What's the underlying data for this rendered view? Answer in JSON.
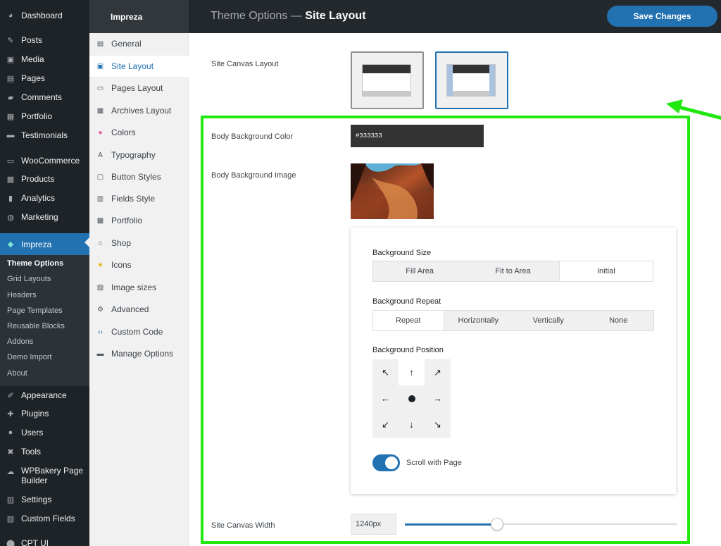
{
  "nav": {
    "items": [
      {
        "label": "Dashboard",
        "icon": "dashboard-icon",
        "glyph": "◕"
      },
      {
        "label": "Posts",
        "icon": "pin-icon",
        "glyph": "✎"
      },
      {
        "label": "Media",
        "icon": "media-icon",
        "glyph": "▣"
      },
      {
        "label": "Pages",
        "icon": "pages-icon",
        "glyph": "▤"
      },
      {
        "label": "Comments",
        "icon": "comments-icon",
        "glyph": "▰"
      },
      {
        "label": "Portfolio",
        "icon": "portfolio-icon",
        "glyph": "▦"
      },
      {
        "label": "Testimonials",
        "icon": "testimonials-icon",
        "glyph": "▬"
      },
      {
        "label": "WooCommerce",
        "icon": "woocommerce-icon",
        "glyph": "▭"
      },
      {
        "label": "Products",
        "icon": "products-icon",
        "glyph": "▩"
      },
      {
        "label": "Analytics",
        "icon": "analytics-icon",
        "glyph": "▮"
      },
      {
        "label": "Marketing",
        "icon": "marketing-icon",
        "glyph": "◍"
      },
      {
        "label": "Impreza",
        "icon": "diamond-icon",
        "glyph": "◆"
      },
      {
        "label": "Appearance",
        "icon": "brush-icon",
        "glyph": "✐"
      },
      {
        "label": "Plugins",
        "icon": "plugin-icon",
        "glyph": "✚"
      },
      {
        "label": "Users",
        "icon": "user-icon",
        "glyph": "●"
      },
      {
        "label": "Tools",
        "icon": "wrench-icon",
        "glyph": "✖"
      },
      {
        "label": "WPBakery Page Builder",
        "icon": "wpbakery-icon",
        "glyph": "☁"
      },
      {
        "label": "Settings",
        "icon": "settings-icon",
        "glyph": "▥"
      },
      {
        "label": "Custom Fields",
        "icon": "custom-fields-icon",
        "glyph": "▧"
      },
      {
        "label": "CPT UI",
        "icon": "cpt-icon",
        "glyph": "⬤"
      }
    ],
    "sub": [
      "Theme Options",
      "Grid Layouts",
      "Headers",
      "Page Templates",
      "Reusable Blocks",
      "Addons",
      "Demo Import",
      "About"
    ]
  },
  "header": {
    "brand": "Impreza",
    "title_prefix": "Theme Options —",
    "title_strong": "Site Layout",
    "save_label": "Save Changes"
  },
  "options_menu": [
    {
      "label": "General",
      "icon": "general-icon",
      "glyph": "▤"
    },
    {
      "label": "Site Layout",
      "icon": "layout-icon",
      "glyph": "▣"
    },
    {
      "label": "Pages Layout",
      "icon": "pages-layout-icon",
      "glyph": "▭"
    },
    {
      "label": "Archives Layout",
      "icon": "archives-icon",
      "glyph": "▦"
    },
    {
      "label": "Colors",
      "icon": "colors-icon",
      "glyph": "●"
    },
    {
      "label": "Typography",
      "icon": "typography-icon",
      "glyph": "A"
    },
    {
      "label": "Button Styles",
      "icon": "button-icon",
      "glyph": "▢"
    },
    {
      "label": "Fields Style",
      "icon": "fields-icon",
      "glyph": "▥"
    },
    {
      "label": "Portfolio",
      "icon": "portfolio-icon",
      "glyph": "▩"
    },
    {
      "label": "Shop",
      "icon": "cart-icon",
      "glyph": "⌂"
    },
    {
      "label": "Icons",
      "icon": "star-icon",
      "glyph": "★"
    },
    {
      "label": "Image sizes",
      "icon": "image-icon",
      "glyph": "▨"
    },
    {
      "label": "Advanced",
      "icon": "gear-icon",
      "glyph": "⚙"
    },
    {
      "label": "Custom Code",
      "icon": "code-icon",
      "glyph": "‹›"
    },
    {
      "label": "Manage Options",
      "icon": "manage-icon",
      "glyph": "▬"
    }
  ],
  "main": {
    "canvas_layout_label": "Site Canvas Layout",
    "body_bg_color_label": "Body Background Color",
    "body_bg_color_value": "#333333",
    "body_bg_image_label": "Body Background Image",
    "bg_size": {
      "label": "Background Size",
      "options": [
        "Fill Area",
        "Fit to Area",
        "Initial"
      ],
      "selected": "Initial"
    },
    "bg_repeat": {
      "label": "Background Repeat",
      "options": [
        "Repeat",
        "Horizontally",
        "Vertically",
        "None"
      ],
      "selected": "Repeat"
    },
    "bg_position": {
      "label": "Background Position",
      "selected": "top center"
    },
    "scroll_label": "Scroll with Page",
    "scroll_on": true,
    "canvas_width_label": "Site Canvas Width",
    "canvas_width_value": "1240px",
    "canvas_width_fraction": 0.34
  },
  "colors": {
    "accent": "#2271b1",
    "highlight": "#21e810",
    "sidebar": "#1d2327"
  }
}
